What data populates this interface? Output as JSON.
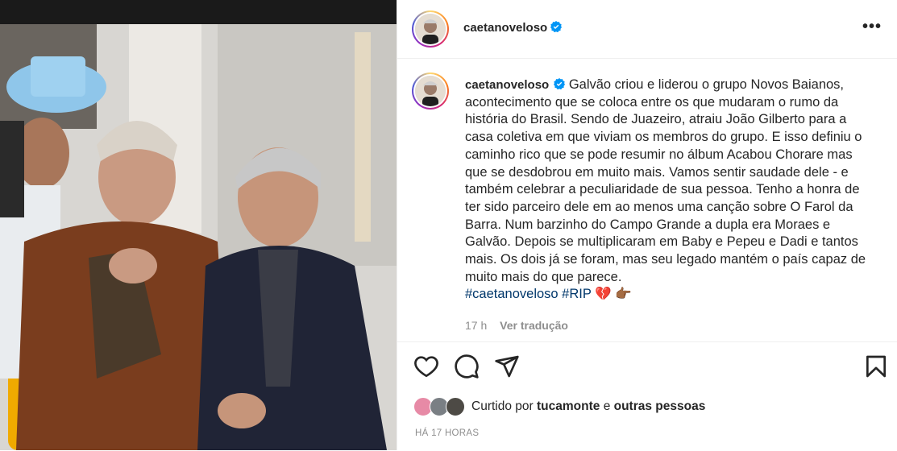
{
  "header": {
    "username": "caetanoveloso",
    "more_label": "•••"
  },
  "caption": {
    "username": "caetanoveloso",
    "text": "Galvão criou e liderou o grupo Novos Baianos, acontecimento que se coloca entre os que mudaram o rumo da história do Brasil. Sendo de Juazeiro, atraiu João Gilberto para a casa coletiva em que viviam os membros do grupo. E isso definiu o caminho rico que se pode resumir no álbum Acabou Chorare mas que se desdobrou em muito mais. Vamos sentir saudade dele - e também celebrar a peculiaridade de sua pessoa. Tenho a honra de ter sido parceiro dele em ao menos uma canção sobre O Farol da Barra. Num barzinho do Campo Grande a dupla era Moraes e Galvão. Depois se multiplicaram em Baby e Pepeu e Dadi e tantos mais. Os dois já se foram, mas seu legado mantém o país capaz de muito mais do que parece.",
    "hashtags": "#caetanoveloso #RIP",
    "emojis": "💔 👉🏾"
  },
  "meta": {
    "age": "17 h",
    "translate": "Ver tradução"
  },
  "likes": {
    "prefix": "Curtido por",
    "user": "tucamonte",
    "connector": "e",
    "others": "outras pessoas"
  },
  "timestamp": "HÁ 17 HORAS",
  "icons": [
    "heart-icon",
    "comment-icon",
    "share-icon",
    "bookmark-icon",
    "verified-icon",
    "more-icon"
  ],
  "colors": {
    "verified": "#0095f6",
    "hashtag": "#00376b",
    "muted": "#8e8e8e"
  }
}
